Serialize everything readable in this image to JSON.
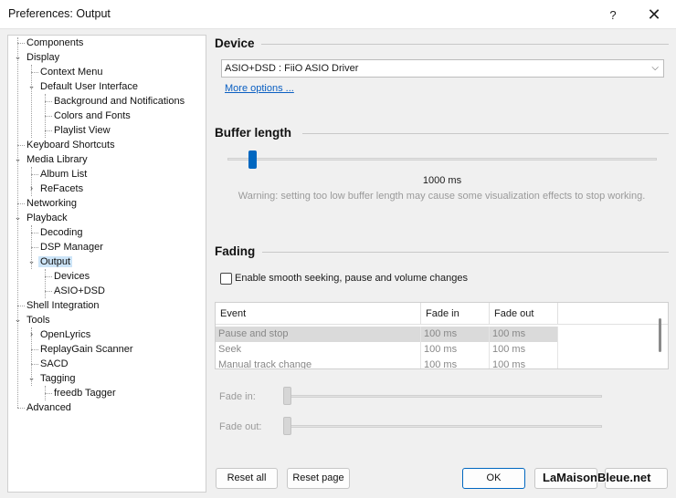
{
  "window": {
    "title": "Preferences: Output",
    "help_label": "?",
    "close_label": "✕"
  },
  "tree": {
    "items": [
      {
        "label": "Components"
      },
      {
        "label": "Display"
      },
      {
        "label": "Context Menu"
      },
      {
        "label": "Default User Interface"
      },
      {
        "label": "Background and Notifications"
      },
      {
        "label": "Colors and Fonts"
      },
      {
        "label": "Playlist View"
      },
      {
        "label": "Keyboard Shortcuts"
      },
      {
        "label": "Media Library"
      },
      {
        "label": "Album List"
      },
      {
        "label": "ReFacets"
      },
      {
        "label": "Networking"
      },
      {
        "label": "Playback"
      },
      {
        "label": "Decoding"
      },
      {
        "label": "DSP Manager"
      },
      {
        "label": "Output"
      },
      {
        "label": "Devices"
      },
      {
        "label": "ASIO+DSD"
      },
      {
        "label": "Shell Integration"
      },
      {
        "label": "Tools"
      },
      {
        "label": "OpenLyrics"
      },
      {
        "label": "ReplayGain Scanner"
      },
      {
        "label": "SACD"
      },
      {
        "label": "Tagging"
      },
      {
        "label": "freedb Tagger"
      },
      {
        "label": "Advanced"
      }
    ]
  },
  "device": {
    "heading": "Device",
    "selected": "ASIO+DSD : FiiO ASIO Driver",
    "more_options": "More options ..."
  },
  "buffer": {
    "heading": "Buffer length",
    "value_text": "1000 ms",
    "level": 0.05,
    "warning": "Warning: setting too low buffer length may cause some visualization effects to stop working."
  },
  "fading": {
    "heading": "Fading",
    "checkbox_label": "Enable smooth seeking, pause and volume changes",
    "columns": [
      "Event",
      "Fade in",
      "Fade out"
    ],
    "rows": [
      [
        "Pause and stop",
        "100 ms",
        "100 ms"
      ],
      [
        "Seek",
        "100 ms",
        "100 ms"
      ],
      [
        "Manual track change",
        "100 ms",
        "100 ms"
      ]
    ],
    "fade_in_label": "Fade in:",
    "fade_out_label": "Fade out:"
  },
  "buttons": {
    "reset_all": "Reset all",
    "reset_page": "Reset page",
    "ok": "OK"
  },
  "watermark": "LaMaisonBleue.net"
}
